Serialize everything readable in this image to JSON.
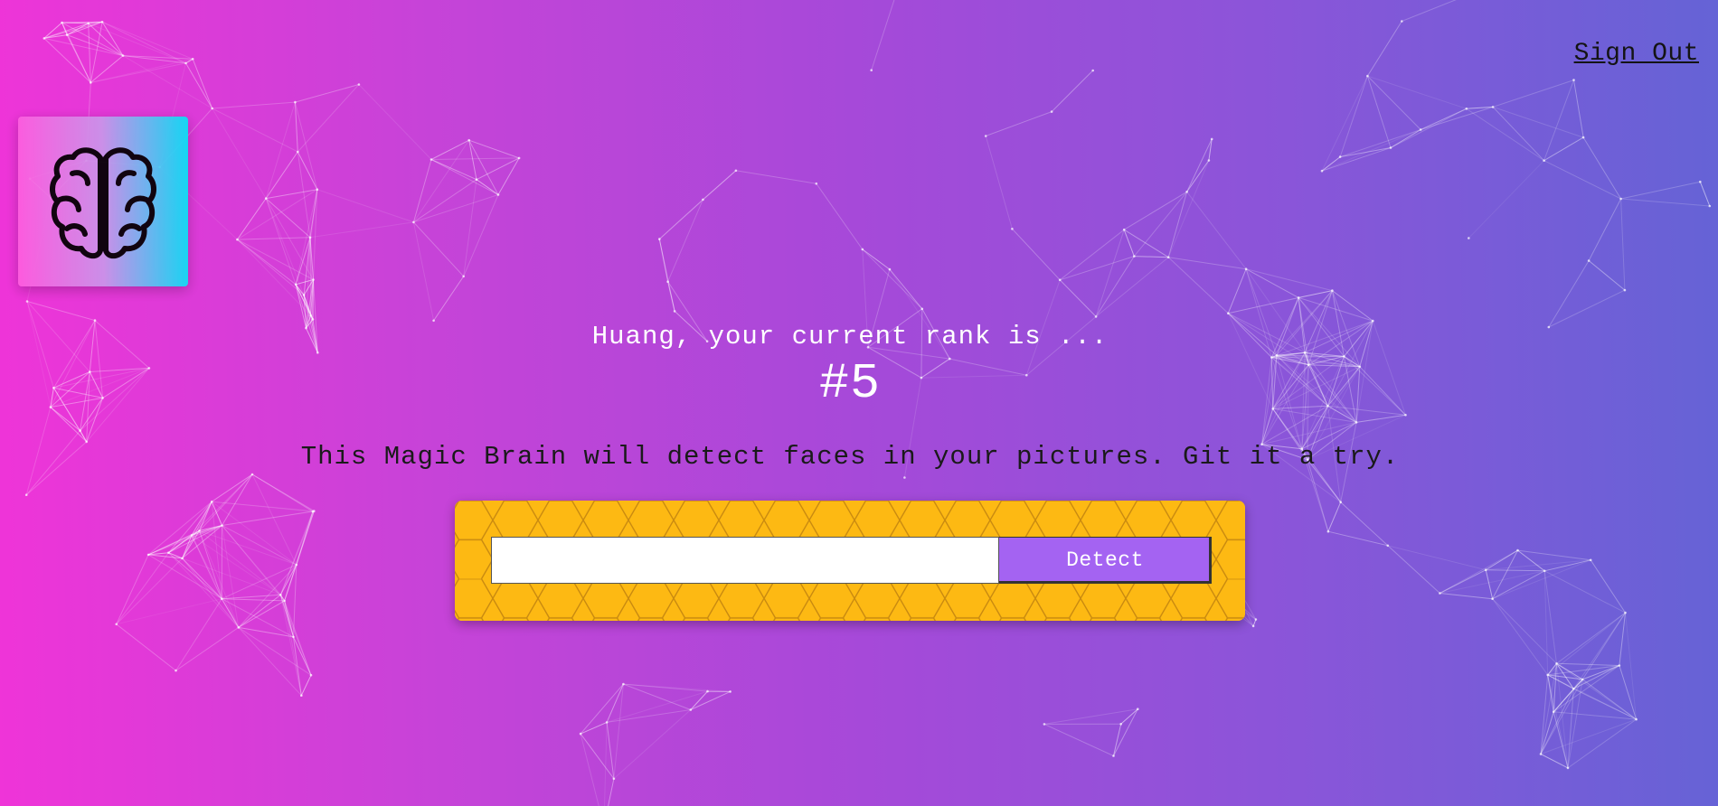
{
  "nav": {
    "signout_label": "Sign Out"
  },
  "logo": {
    "icon": "brain-icon"
  },
  "rank": {
    "intro": "Huang, your current rank is ...",
    "value": "#5"
  },
  "tagline": "This Magic Brain will detect faces in your pictures. Git it a try.",
  "form": {
    "input_value": "",
    "detect_label": "Detect"
  },
  "colors": {
    "gradient_start": "#ef34d8",
    "gradient_end": "#6563d6",
    "form_background": "#fdb913",
    "button": "#a463f2"
  }
}
